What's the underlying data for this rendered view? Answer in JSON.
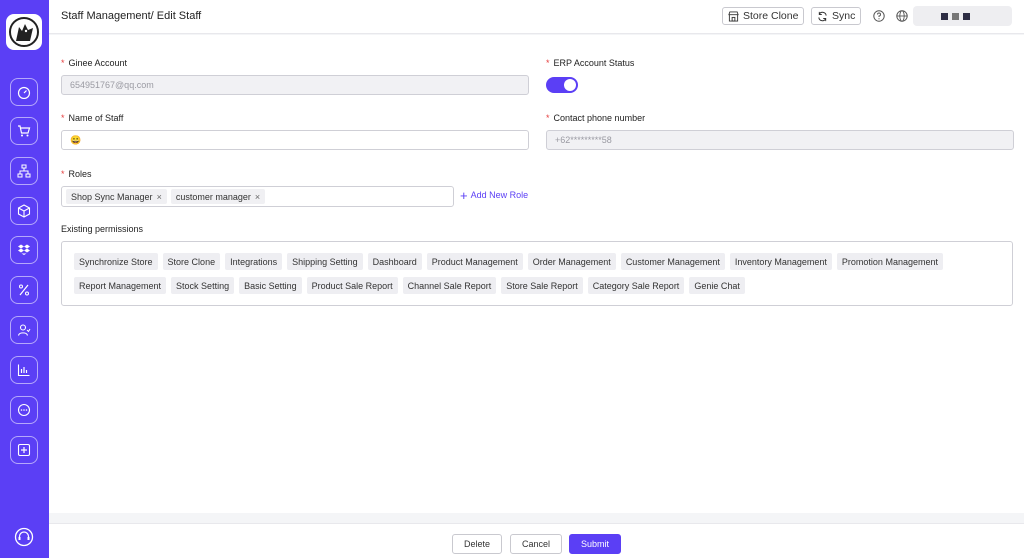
{
  "header": {
    "title": "Staff Management/ Edit Staff",
    "store_clone_label": "Store Clone",
    "sync_label": "Sync"
  },
  "sidebar": {
    "items": [
      {
        "icon": "dashboard-icon"
      },
      {
        "icon": "cart-icon"
      },
      {
        "icon": "hierarchy-icon"
      },
      {
        "icon": "box-icon"
      },
      {
        "icon": "dropbox-icon"
      },
      {
        "icon": "percent-icon"
      },
      {
        "icon": "users-icon"
      },
      {
        "icon": "chart-icon"
      },
      {
        "icon": "chat-icon"
      },
      {
        "icon": "plus-square-icon"
      }
    ]
  },
  "form": {
    "ginee_account_label": "Ginee Account",
    "ginee_account_value": "654951767@qq.com",
    "erp_status_label": "ERP Account Status",
    "erp_status_on": true,
    "name_label": "Name of Staff",
    "name_value": "😀",
    "phone_label": "Contact phone number",
    "phone_value": "+62*********58",
    "roles_label": "Roles",
    "roles": [
      "Shop Sync Manager",
      "customer manager"
    ],
    "add_role_label": "Add New Role",
    "permissions_label": "Existing permissions",
    "permissions_row1": [
      "Synchronize Store",
      "Store Clone",
      "Integrations",
      "Shipping Setting",
      "Dashboard",
      "Product Management",
      "Order Management",
      "Customer Management",
      "Inventory Management",
      "Promotion Management"
    ],
    "permissions_row2": [
      "Report Management",
      "Stock Setting",
      "Basic Setting",
      "Product Sale Report",
      "Channel Sale Report",
      "Store Sale Report",
      "Category Sale Report",
      "Genie Chat"
    ]
  },
  "footer": {
    "delete_label": "Delete",
    "cancel_label": "Cancel",
    "submit_label": "Submit"
  },
  "colors": {
    "accent": "#5b3ff5",
    "required": "#e53e3e"
  }
}
